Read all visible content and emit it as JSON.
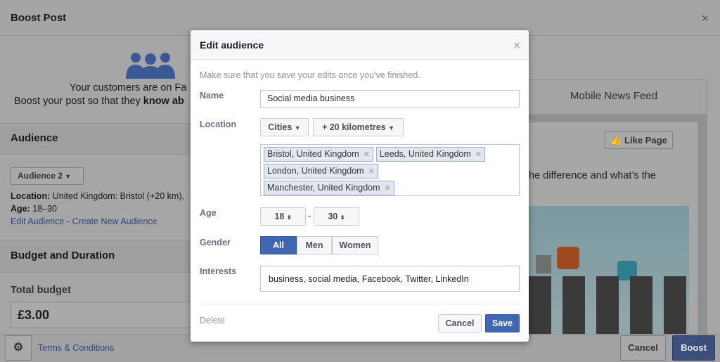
{
  "page": {
    "title": "Boost Post",
    "close": "×"
  },
  "intro": {
    "line1": "Your customers are on Fa",
    "line2_pre": "Boost your post so that they ",
    "line2_bold": "know ab"
  },
  "audience": {
    "heading": "Audience",
    "selector": "Audience 2",
    "location_label": "Location:",
    "location_value": " United Kingdom: Bristol (+20 km),",
    "age_label": "Age:",
    "age_value": " 18–30",
    "edit_link": "Edit Audience",
    "separator": " - ",
    "create_link": "Create New Audience"
  },
  "budget": {
    "heading": "Budget and Duration",
    "total_label": "Total budget",
    "total_value": "£3.00"
  },
  "footer": {
    "terms": "Terms & Conditions",
    "cancel": "Cancel",
    "boost": "Boost"
  },
  "preview": {
    "tab": "Mobile News Feed",
    "like_page": "Like Page",
    "text": "he difference and what’s the"
  },
  "modal": {
    "title": "Edit audience",
    "close": "×",
    "hint": "Make sure that you save your edits once you've finished.",
    "name_label": "Name",
    "name_value": "Social media business",
    "location_label": "Location",
    "location_type": "Cities",
    "radius": "+ 20 kilometres",
    "locations": [
      "Bristol, United Kingdom",
      "Leeds, United Kingdom",
      "London, United Kingdom",
      "Manchester, United Kingdom"
    ],
    "age_label": "Age",
    "age_min": "18",
    "age_max": "30",
    "age_sep": "-",
    "gender_label": "Gender",
    "genders": [
      "All",
      "Men",
      "Women"
    ],
    "gender_selected": "All",
    "interests_label": "Interests",
    "interests_value": "business, social media, Facebook, Twitter, LinkedIn",
    "delete": "Delete",
    "cancel": "Cancel",
    "save": "Save"
  },
  "colors": {
    "primary": "#4267b2",
    "overlay": "#a6a6a6"
  }
}
